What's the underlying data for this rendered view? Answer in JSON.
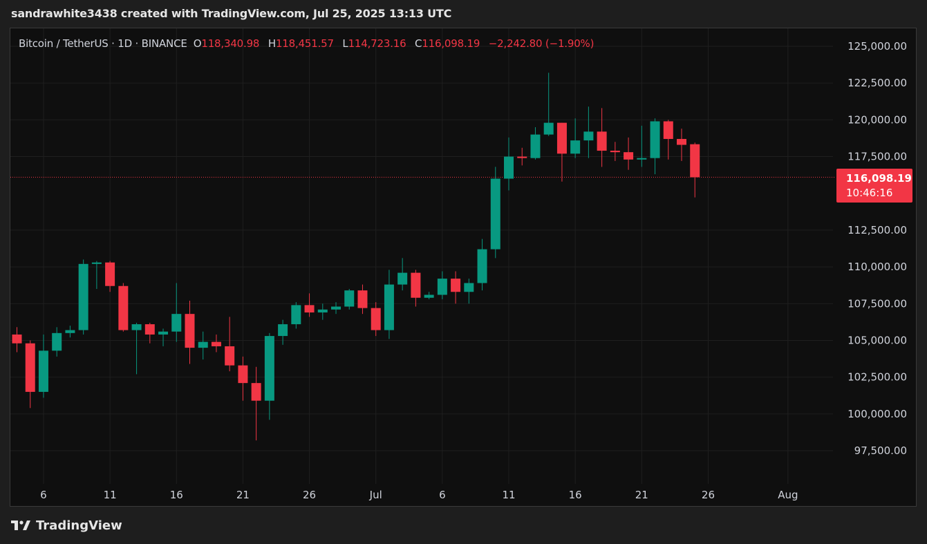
{
  "header": {
    "caption": "sandrawhite3438 created with TradingView.com, Jul 25, 2025 13:13 UTC"
  },
  "legend": {
    "symbol": "Bitcoin / TetherUS · 1D · BINANCE",
    "open_label": "O",
    "open": "118,340.98",
    "high_label": "H",
    "high": "118,451.57",
    "low_label": "L",
    "low": "114,723.16",
    "close_label": "C",
    "close": "116,098.19",
    "change": "−2,242.80 (−1.90%)"
  },
  "price_tag": {
    "price": "116,098.19",
    "countdown": "10:46:16"
  },
  "footer": {
    "brand": "TradingView"
  },
  "colors": {
    "up": "#089981",
    "down": "#f23645",
    "background": "#0f0f0f",
    "grid": "#1f1f1f",
    "text": "#d1d4dc"
  },
  "chart_data": {
    "type": "candlestick",
    "ylim": [
      95000,
      127000
    ],
    "last_price": 116098.19,
    "y_ticks": [
      {
        "value": 125000,
        "label": "125,000.00"
      },
      {
        "value": 122500,
        "label": "122,500.00"
      },
      {
        "value": 120000,
        "label": "120,000.00"
      },
      {
        "value": 117500,
        "label": "117,500.00"
      },
      {
        "value": 112500,
        "label": "112,500.00"
      },
      {
        "value": 110000,
        "label": "110,000.00"
      },
      {
        "value": 107500,
        "label": "107,500.00"
      },
      {
        "value": 105000,
        "label": "105,000.00"
      },
      {
        "value": 102500,
        "label": "102,500.00"
      },
      {
        "value": 100000,
        "label": "100,000.00"
      },
      {
        "value": 97500,
        "label": "97,500.00"
      }
    ],
    "x_ticks": [
      {
        "index": 2,
        "label": "6"
      },
      {
        "index": 7,
        "label": "11"
      },
      {
        "index": 12,
        "label": "16"
      },
      {
        "index": 17,
        "label": "21"
      },
      {
        "index": 22,
        "label": "26"
      },
      {
        "index": 27,
        "label": "Jul"
      },
      {
        "index": 32,
        "label": "6"
      },
      {
        "index": 37,
        "label": "11"
      },
      {
        "index": 42,
        "label": "16"
      },
      {
        "index": 47,
        "label": "21"
      },
      {
        "index": 52,
        "label": "26"
      },
      {
        "index": 58,
        "label": "Aug"
      }
    ],
    "candles": [
      {
        "date": "Jun 4",
        "o": 105400,
        "h": 105900,
        "l": 104200,
        "c": 104800
      },
      {
        "date": "Jun 5",
        "o": 104800,
        "h": 105000,
        "l": 100400,
        "c": 101500
      },
      {
        "date": "Jun 6",
        "o": 101500,
        "h": 105400,
        "l": 101100,
        "c": 104300
      },
      {
        "date": "Jun 7",
        "o": 104300,
        "h": 105900,
        "l": 103900,
        "c": 105500
      },
      {
        "date": "Jun 8",
        "o": 105500,
        "h": 106000,
        "l": 105200,
        "c": 105700
      },
      {
        "date": "Jun 9",
        "o": 105700,
        "h": 110500,
        "l": 105400,
        "c": 110200
      },
      {
        "date": "Jun 10",
        "o": 110200,
        "h": 110400,
        "l": 108500,
        "c": 110300
      },
      {
        "date": "Jun 11",
        "o": 110300,
        "h": 110400,
        "l": 108300,
        "c": 108700
      },
      {
        "date": "Jun 12",
        "o": 108700,
        "h": 108900,
        "l": 105600,
        "c": 105700
      },
      {
        "date": "Jun 13",
        "o": 105700,
        "h": 106200,
        "l": 102700,
        "c": 106100
      },
      {
        "date": "Jun 14",
        "o": 106100,
        "h": 106200,
        "l": 104800,
        "c": 105400
      },
      {
        "date": "Jun 15",
        "o": 105400,
        "h": 105800,
        "l": 104600,
        "c": 105600
      },
      {
        "date": "Jun 16",
        "o": 105600,
        "h": 108900,
        "l": 104900,
        "c": 106800
      },
      {
        "date": "Jun 17",
        "o": 106800,
        "h": 107700,
        "l": 103400,
        "c": 104500
      },
      {
        "date": "Jun 18",
        "o": 104500,
        "h": 105600,
        "l": 103700,
        "c": 104900
      },
      {
        "date": "Jun 19",
        "o": 104900,
        "h": 105400,
        "l": 104200,
        "c": 104600
      },
      {
        "date": "Jun 20",
        "o": 104600,
        "h": 106600,
        "l": 102900,
        "c": 103300
      },
      {
        "date": "Jun 21",
        "o": 103300,
        "h": 103900,
        "l": 100900,
        "c": 102100
      },
      {
        "date": "Jun 22",
        "o": 102100,
        "h": 103200,
        "l": 98200,
        "c": 100900
      },
      {
        "date": "Jun 23",
        "o": 100900,
        "h": 105500,
        "l": 99600,
        "c": 105300
      },
      {
        "date": "Jun 24",
        "o": 105300,
        "h": 106400,
        "l": 104700,
        "c": 106100
      },
      {
        "date": "Jun 25",
        "o": 106100,
        "h": 107600,
        "l": 105800,
        "c": 107400
      },
      {
        "date": "Jun 26",
        "o": 107400,
        "h": 108200,
        "l": 106600,
        "c": 106900
      },
      {
        "date": "Jun 27",
        "o": 106900,
        "h": 107500,
        "l": 106400,
        "c": 107100
      },
      {
        "date": "Jun 28",
        "o": 107100,
        "h": 107600,
        "l": 106800,
        "c": 107300
      },
      {
        "date": "Jun 29",
        "o": 107300,
        "h": 108500,
        "l": 107100,
        "c": 108400
      },
      {
        "date": "Jun 30",
        "o": 108400,
        "h": 108800,
        "l": 106800,
        "c": 107200
      },
      {
        "date": "Jul 1",
        "o": 107200,
        "h": 107600,
        "l": 105300,
        "c": 105700
      },
      {
        "date": "Jul 2",
        "o": 105700,
        "h": 109800,
        "l": 105100,
        "c": 108800
      },
      {
        "date": "Jul 3",
        "o": 108800,
        "h": 110600,
        "l": 108400,
        "c": 109600
      },
      {
        "date": "Jul 4",
        "o": 109600,
        "h": 109800,
        "l": 107300,
        "c": 107900
      },
      {
        "date": "Jul 5",
        "o": 107900,
        "h": 108300,
        "l": 107800,
        "c": 108100
      },
      {
        "date": "Jul 6",
        "o": 108100,
        "h": 109700,
        "l": 107800,
        "c": 109200
      },
      {
        "date": "Jul 7",
        "o": 109200,
        "h": 109700,
        "l": 107500,
        "c": 108300
      },
      {
        "date": "Jul 8",
        "o": 108300,
        "h": 109200,
        "l": 107500,
        "c": 108900
      },
      {
        "date": "Jul 9",
        "o": 108900,
        "h": 111900,
        "l": 108400,
        "c": 111200
      },
      {
        "date": "Jul 10",
        "o": 111200,
        "h": 116800,
        "l": 110600,
        "c": 116000
      },
      {
        "date": "Jul 11",
        "o": 116000,
        "h": 118800,
        "l": 115200,
        "c": 117500
      },
      {
        "date": "Jul 12",
        "o": 117500,
        "h": 118100,
        "l": 116900,
        "c": 117400
      },
      {
        "date": "Jul 13",
        "o": 117400,
        "h": 119500,
        "l": 117300,
        "c": 119000
      },
      {
        "date": "Jul 14",
        "o": 119000,
        "h": 123200,
        "l": 118900,
        "c": 119800
      },
      {
        "date": "Jul 15",
        "o": 119800,
        "h": 119800,
        "l": 115800,
        "c": 117700
      },
      {
        "date": "Jul 16",
        "o": 117700,
        "h": 120100,
        "l": 117400,
        "c": 118600
      },
      {
        "date": "Jul 17",
        "o": 118600,
        "h": 120900,
        "l": 117400,
        "c": 119200
      },
      {
        "date": "Jul 18",
        "o": 119200,
        "h": 120800,
        "l": 116800,
        "c": 117900
      },
      {
        "date": "Jul 19",
        "o": 117900,
        "h": 118500,
        "l": 117200,
        "c": 117800
      },
      {
        "date": "Jul 20",
        "o": 117800,
        "h": 118800,
        "l": 116600,
        "c": 117300
      },
      {
        "date": "Jul 21",
        "o": 117300,
        "h": 119600,
        "l": 116800,
        "c": 117400
      },
      {
        "date": "Jul 22",
        "o": 117400,
        "h": 120100,
        "l": 116300,
        "c": 119900
      },
      {
        "date": "Jul 23",
        "o": 119900,
        "h": 120000,
        "l": 117300,
        "c": 118700
      },
      {
        "date": "Jul 24",
        "o": 118700,
        "h": 119400,
        "l": 117200,
        "c": 118300
      },
      {
        "date": "Jul 25",
        "o": 118340.98,
        "h": 118451.57,
        "l": 114723.16,
        "c": 116098.19
      }
    ]
  }
}
